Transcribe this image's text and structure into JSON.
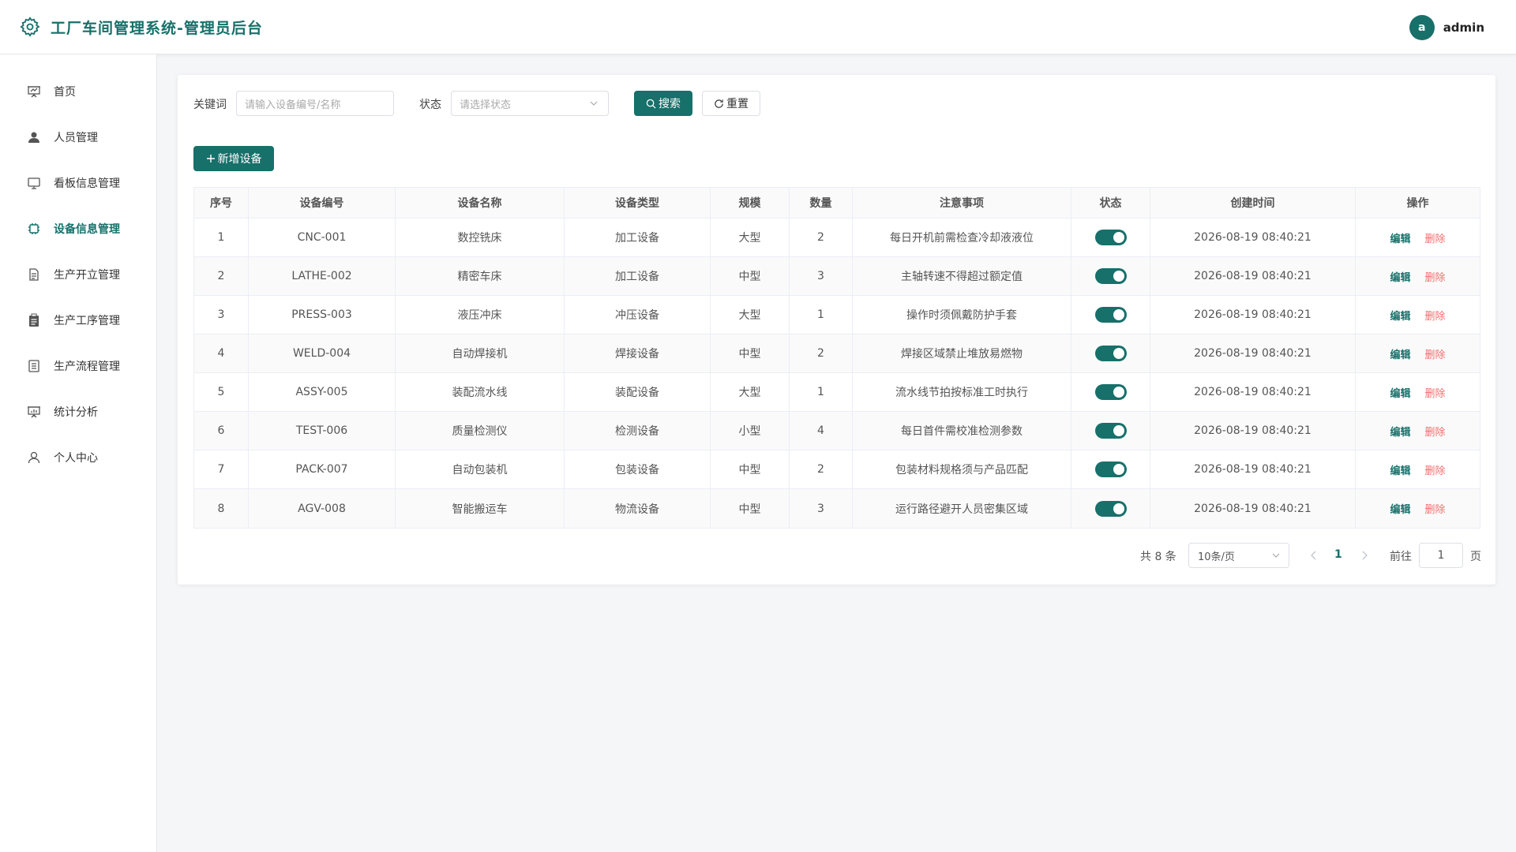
{
  "app": {
    "title": "工厂车间管理系统-管理员后台",
    "accent": "#17706a"
  },
  "user": {
    "avatar_letter": "a",
    "name": "admin"
  },
  "sidebar": {
    "active": "设备信息管理",
    "items": [
      {
        "label": "首页",
        "icon": "presentation-icon"
      },
      {
        "label": "人员管理",
        "icon": "user-icon"
      },
      {
        "label": "看板信息管理",
        "icon": "monitor-icon"
      },
      {
        "label": "设备信息管理",
        "icon": "cpu-icon"
      },
      {
        "label": "生产开立管理",
        "icon": "document-icon"
      },
      {
        "label": "生产工序管理",
        "icon": "clipboard-icon"
      },
      {
        "label": "生产流程管理",
        "icon": "list-document-icon"
      },
      {
        "label": "统计分析",
        "icon": "chart-board-icon"
      },
      {
        "label": "个人中心",
        "icon": "user-outline-icon"
      }
    ]
  },
  "filters": {
    "keyword_label": "关键词",
    "keyword_placeholder": "请输入设备编号/名称",
    "status_label": "状态",
    "status_placeholder": "请选择状态",
    "search_label": "搜索",
    "reset_label": "重置",
    "add_label": "新增设备"
  },
  "table": {
    "columns": [
      "序号",
      "设备编号",
      "设备名称",
      "设备类型",
      "规模",
      "数量",
      "注意事项",
      "状态",
      "创建时间",
      "操作"
    ],
    "edit_label": "编辑",
    "delete_label": "删除",
    "rows": [
      {
        "no": "1",
        "code": "CNC-001",
        "name": "数控铣床",
        "type": "加工设备",
        "scale": "大型",
        "qty": "2",
        "note": "每日开机前需检查冷却液液位",
        "enabled": true,
        "created": "2026-08-19 08:40:21"
      },
      {
        "no": "2",
        "code": "LATHE-002",
        "name": "精密车床",
        "type": "加工设备",
        "scale": "中型",
        "qty": "3",
        "note": "主轴转速不得超过额定值",
        "enabled": true,
        "created": "2026-08-19 08:40:21"
      },
      {
        "no": "3",
        "code": "PRESS-003",
        "name": "液压冲床",
        "type": "冲压设备",
        "scale": "大型",
        "qty": "1",
        "note": "操作时须佩戴防护手套",
        "enabled": true,
        "created": "2026-08-19 08:40:21"
      },
      {
        "no": "4",
        "code": "WELD-004",
        "name": "自动焊接机",
        "type": "焊接设备",
        "scale": "中型",
        "qty": "2",
        "note": "焊接区域禁止堆放易燃物",
        "enabled": true,
        "created": "2026-08-19 08:40:21"
      },
      {
        "no": "5",
        "code": "ASSY-005",
        "name": "装配流水线",
        "type": "装配设备",
        "scale": "大型",
        "qty": "1",
        "note": "流水线节拍按标准工时执行",
        "enabled": true,
        "created": "2026-08-19 08:40:21"
      },
      {
        "no": "6",
        "code": "TEST-006",
        "name": "质量检测仪",
        "type": "检测设备",
        "scale": "小型",
        "qty": "4",
        "note": "每日首件需校准检测参数",
        "enabled": true,
        "created": "2026-08-19 08:40:21"
      },
      {
        "no": "7",
        "code": "PACK-007",
        "name": "自动包装机",
        "type": "包装设备",
        "scale": "中型",
        "qty": "2",
        "note": "包装材料规格须与产品匹配",
        "enabled": true,
        "created": "2026-08-19 08:40:21"
      },
      {
        "no": "8",
        "code": "AGV-008",
        "name": "智能搬运车",
        "type": "物流设备",
        "scale": "中型",
        "qty": "3",
        "note": "运行路径避开人员密集区域",
        "enabled": true,
        "created": "2026-08-19 08:40:21"
      }
    ]
  },
  "pagination": {
    "total_text": "共 8 条",
    "page_size": "10条/页",
    "current_page": "1",
    "goto_label": "前往",
    "goto_value": "1",
    "page_suffix": "页"
  }
}
